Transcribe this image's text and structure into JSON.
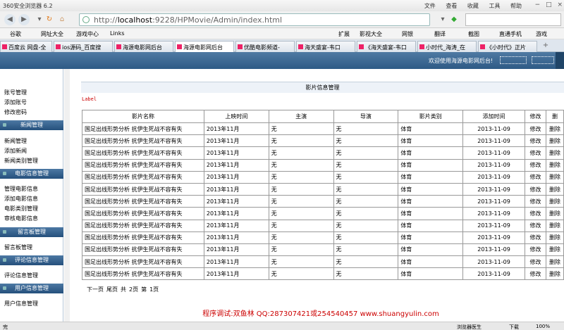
{
  "browser": {
    "title": "360安全浏览器 6.2",
    "menu": [
      "文件",
      "查看",
      "收藏",
      "工具",
      "帮助"
    ],
    "address": "http://localhost:9228/HPMovie/Admin/index.html",
    "address_host": "localhost",
    "address_path": ":9228/HPMovie/Admin/index.html",
    "bookmarks": [
      "谷歌",
      "网址大全",
      "游戏中心",
      "Links",
      "扩展",
      "影视大全",
      "网银",
      "翻译",
      "截图",
      "直通手机",
      "游戏"
    ],
    "tabs": [
      "百度云 网盘-全",
      "ios源码_百度搜",
      "海源电影网后台",
      "海源电影网后台",
      "优酷电影频道-",
      "海天盛宴-韦口",
      "《海天盛宴-韦口",
      "小时代_海涛_在",
      "《小时代》正片"
    ]
  },
  "header": {
    "welcome": "欢迎使用海源电影网后台!"
  },
  "sidebar": {
    "top_items": [
      "账号管理",
      "添加账号",
      "修改密码"
    ],
    "groups": [
      {
        "title": "新闻管理",
        "items": [
          "新闻管理",
          "添加新闻",
          "新闻类别管理"
        ]
      },
      {
        "title": "电影信息管理",
        "items": [
          "管理电影信息",
          "添加电影信息",
          "电影类别管理",
          "审核电影信息"
        ]
      },
      {
        "title": "留言板管理",
        "items": [
          "留言板管理"
        ]
      },
      {
        "title": "评论信息管理",
        "items": [
          "评论信息管理"
        ]
      },
      {
        "title": "用户信息管理",
        "items": [
          "用户信息管理"
        ]
      }
    ]
  },
  "main": {
    "panel_title": "影片信息管理",
    "label": "Label",
    "columns": [
      "影片名称",
      "上映时间",
      "主演",
      "导演",
      "影片类别",
      "添加时间",
      "修改",
      "删"
    ],
    "rows": [
      [
        "国足出线形势分析 抗伊生死战不容有失",
        "2013年11月",
        "无",
        "无",
        "体育",
        "2013-11-09",
        "修改",
        "删除"
      ],
      [
        "国足出线形势分析 抗伊生死战不容有失",
        "2013年11月",
        "无",
        "无",
        "体育",
        "2013-11-09",
        "修改",
        "删除"
      ],
      [
        "国足出线形势分析 抗伊生死战不容有失",
        "2013年11月",
        "无",
        "无",
        "体育",
        "2013-11-09",
        "修改",
        "删除"
      ],
      [
        "国足出线形势分析 抗伊生死战不容有失",
        "2013年11月",
        "无",
        "无",
        "体育",
        "2013-11-09",
        "修改",
        "删除"
      ],
      [
        "国足出线形势分析 抗伊生死战不容有失",
        "2013年11月",
        "无",
        "无",
        "体育",
        "2013-11-09",
        "修改",
        "删除"
      ],
      [
        "国足出线形势分析 抗伊生死战不容有失",
        "2013年11月",
        "无",
        "无",
        "体育",
        "2013-11-09",
        "修改",
        "删除"
      ],
      [
        "国足出线形势分析 抗伊生死战不容有失",
        "2013年11月",
        "无",
        "无",
        "体育",
        "2013-11-09",
        "修改",
        "删除"
      ],
      [
        "国足出线形势分析 抗伊生死战不容有失",
        "2013年11月",
        "无",
        "无",
        "体育",
        "2013-11-09",
        "修改",
        "删除"
      ],
      [
        "国足出线形势分析 抗伊生死战不容有失",
        "2013年11月",
        "无",
        "无",
        "体育",
        "2013-11-09",
        "修改",
        "删除"
      ],
      [
        "国足出线形势分析 抗伊生死战不容有失",
        "2013年11月",
        "无",
        "无",
        "体育",
        "2013-11-09",
        "修改",
        "删除"
      ],
      [
        "国足出线形势分析 抗伊生死战不容有失",
        "2013年11月",
        "无",
        "无",
        "体育",
        "2013-11-09",
        "修改",
        "删除"
      ],
      [
        "国足出线形势分析 抗伊生死战不容有失",
        "2013年11月",
        "无",
        "无",
        "体育",
        "2013-11-09",
        "修改",
        "删除"
      ],
      [
        "国足出线形势分析 抗伊生死战不容有失",
        "2013年11月",
        "无",
        "无",
        "体育",
        "2013-11-09",
        "修改",
        "删除"
      ]
    ],
    "pager": [
      "下一页",
      "尾页",
      "共",
      "2页",
      "第",
      "1页"
    ]
  },
  "footer": {
    "text": "程序调试:双鱼林 QQ:287307421或254540457 www.shuangyulin.com"
  },
  "statusbar": {
    "left": "完",
    "doctor": "浏览器医生",
    "download": "下载",
    "zoom": "100%"
  }
}
